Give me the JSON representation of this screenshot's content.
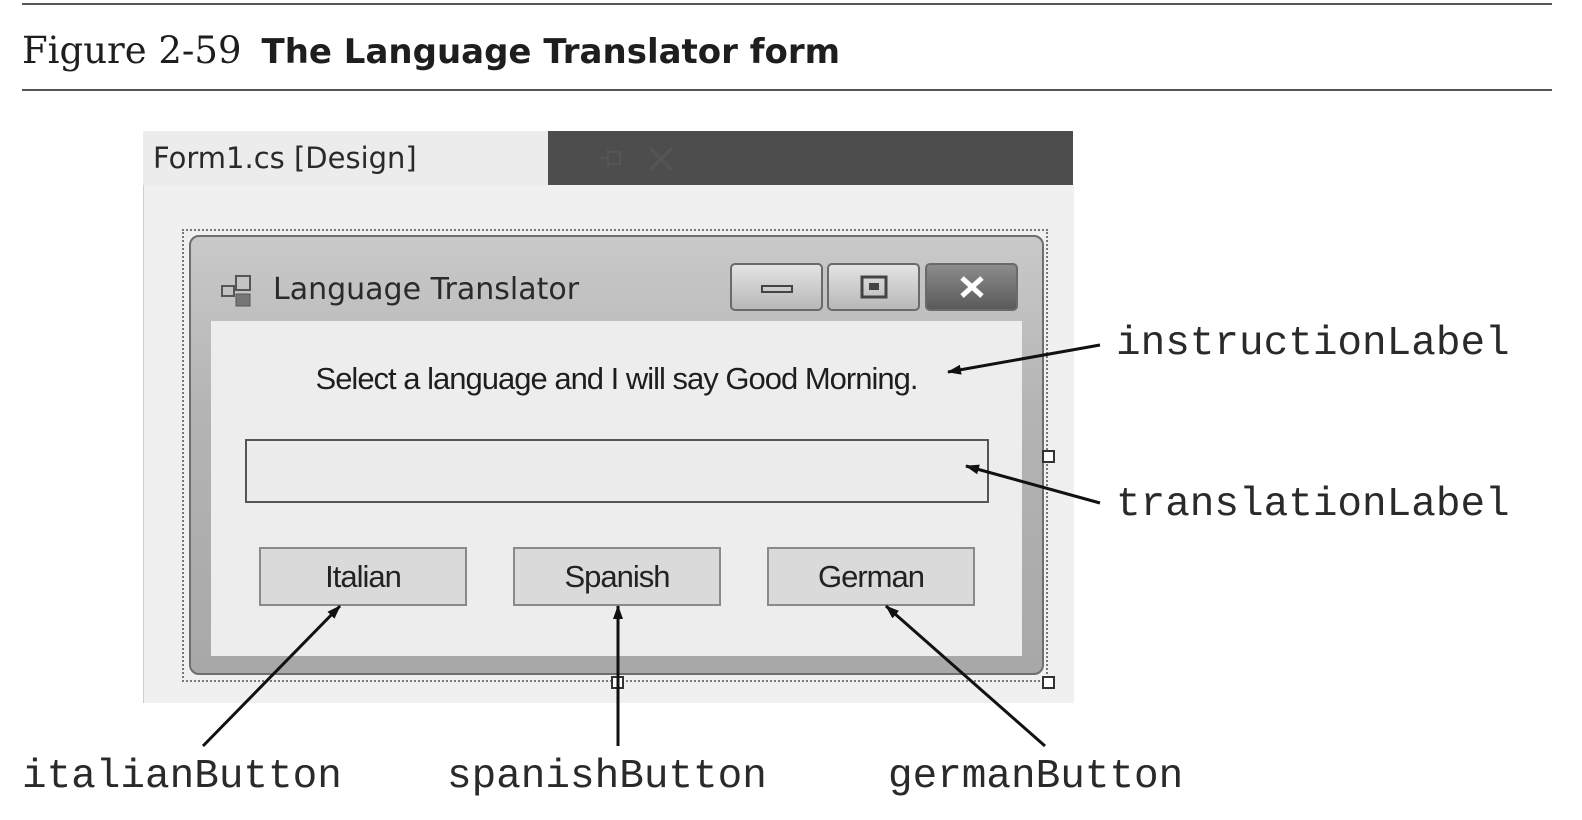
{
  "figure": {
    "number": "Figure 2-59",
    "title": "The Language Translator form"
  },
  "designer_tab": {
    "label": "Form1.cs [Design]",
    "pin_icon": "pin-icon",
    "close_icon": "close-icon"
  },
  "form": {
    "title": "Language Translator",
    "icon": "form-icon",
    "caption_buttons": [
      "minimize-icon",
      "maximize-icon",
      "close-icon"
    ],
    "instruction_text": "Select a language and I will say Good Morning.",
    "translation_text": "",
    "buttons": {
      "italian": "Italian",
      "spanish": "Spanish",
      "german": "German"
    }
  },
  "callouts": {
    "instruction": "instructionLabel",
    "translation": "translationLabel",
    "italian": "italianButton",
    "spanish": "spanishButton",
    "german": "germanButton"
  }
}
